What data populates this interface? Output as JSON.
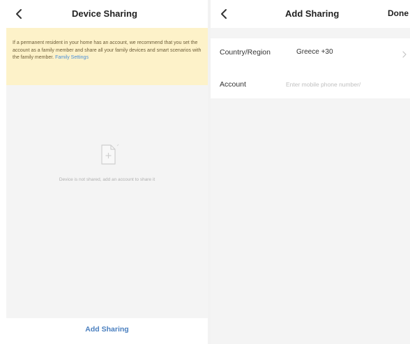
{
  "left_screen": {
    "title": "Device Sharing",
    "notice_text": "If a permanent resident in your home has an account, we recommend that you set the account as a family member and share all your family devices and smart scenarios with the family member.",
    "notice_link": "Family Settings",
    "empty_text": "Device is not shared, add an account to share it",
    "add_button": "Add Sharing",
    "icons": {
      "back": "chevron-left-icon",
      "empty": "document-plus-icon"
    }
  },
  "right_screen": {
    "title": "Add Sharing",
    "done_label": "Done",
    "country_label": "Country/Region",
    "country_value": "Greece +30",
    "account_label": "Account",
    "account_placeholder": "Enter mobile phone number/",
    "icons": {
      "back": "chevron-left-icon",
      "select": "chevron-right-icon"
    }
  },
  "colors": {
    "notice_bg": "#fdf2c9",
    "link": "#4a8fd8",
    "button_text": "#4a7fbf",
    "gray_bg": "#f4f4f4"
  }
}
